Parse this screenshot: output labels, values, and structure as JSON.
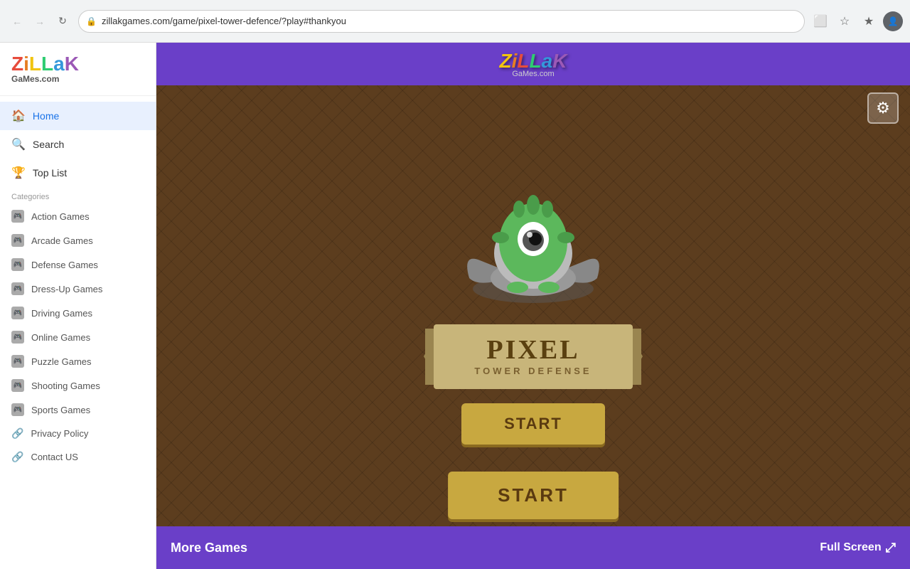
{
  "browser": {
    "url": "zillakgames.com/game/pixel-tower-defence/?play#thankyou",
    "back_disabled": true,
    "forward_disabled": true
  },
  "sidebar": {
    "logo": {
      "zillak": "ZiLLaK",
      "games": "GaMes.com"
    },
    "nav": [
      {
        "id": "home",
        "label": "Home",
        "icon": "🏠",
        "active": true
      },
      {
        "id": "search",
        "label": "Search",
        "icon": "🔍",
        "active": false
      },
      {
        "id": "toplist",
        "label": "Top List",
        "icon": "🏆",
        "active": false
      }
    ],
    "categories_label": "Categories",
    "categories": [
      {
        "id": "action",
        "label": "Action Games"
      },
      {
        "id": "arcade",
        "label": "Arcade Games"
      },
      {
        "id": "defense",
        "label": "Defense Games"
      },
      {
        "id": "dressup",
        "label": "Dress-Up Games"
      },
      {
        "id": "driving",
        "label": "Driving Games"
      },
      {
        "id": "online",
        "label": "Online Games"
      },
      {
        "id": "puzzle",
        "label": "Puzzle Games"
      },
      {
        "id": "shooting",
        "label": "Shooting Games"
      },
      {
        "id": "sports",
        "label": "Sports Games"
      },
      {
        "id": "privacy",
        "label": "Privacy Policy",
        "icon": "🔗"
      },
      {
        "id": "contact",
        "label": "Contact US",
        "icon": "🔗"
      }
    ]
  },
  "game": {
    "header_logo": "ZiLLaK",
    "header_logo_sub": "GaMes.com",
    "title_main": "PIXEL",
    "title_sub": "TOWER DEFENSE",
    "start_label": "START",
    "start_large_label": "START",
    "more_games_label": "More Games",
    "fullscreen_label": "Full Screen",
    "settings_icon": "⚙"
  }
}
